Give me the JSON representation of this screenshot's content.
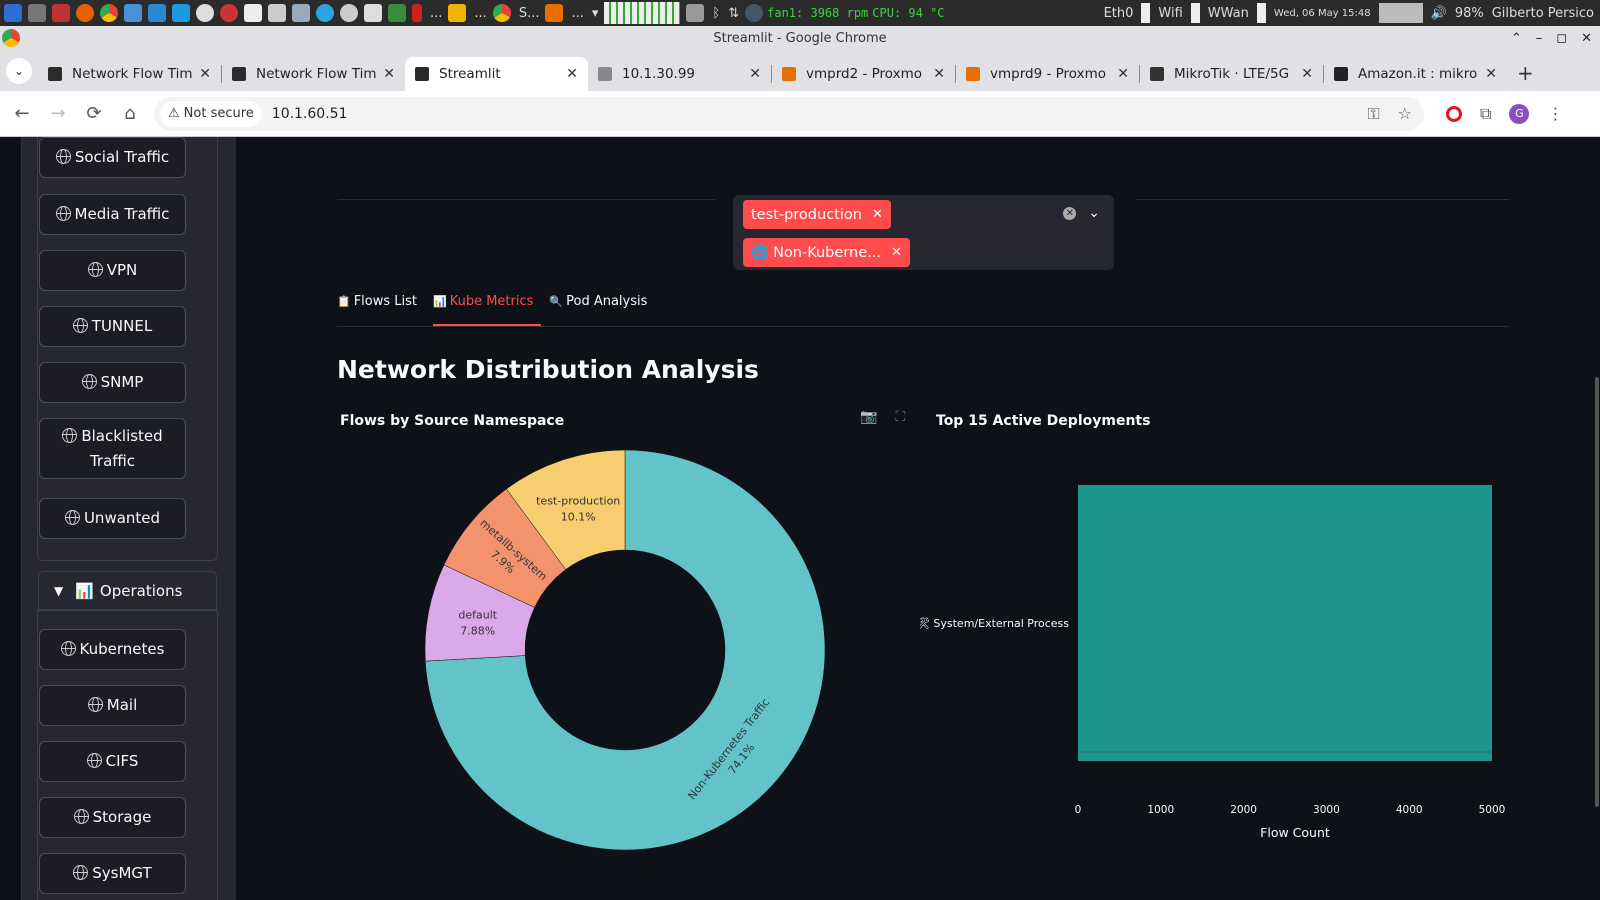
{
  "taskbar": {
    "item1": "S...",
    "item2": "...",
    "fan": "fan1: 3968 rpm",
    "cpu": "CPU: 94 °C",
    "eth": "Eth0",
    "wifi": "Wifi",
    "wwan": "WWan",
    "clock": "Wed, 06 May  15:48",
    "battery": "98%",
    "user": "Gilberto Persico"
  },
  "window": {
    "title": "Streamlit - Google Chrome"
  },
  "tabs": [
    {
      "label": "Network Flow Tim",
      "color": "#2b2b2b"
    },
    {
      "label": "Network Flow Tim",
      "color": "#2b2b2b"
    },
    {
      "label": "Streamlit",
      "color": "#2b2b2b",
      "active": true
    },
    {
      "label": "10.1.30.99",
      "color": "#888"
    },
    {
      "label": "vmprd2 - Proxmo",
      "color": "#e57000"
    },
    {
      "label": "vmprd9 - Proxmo",
      "color": "#e57000"
    },
    {
      "label": "MikroTik · LTE/5G",
      "color": "#333"
    },
    {
      "label": "Amazon.it : mikro",
      "color": "#222"
    }
  ],
  "address": {
    "security": "Not secure",
    "url": "10.1.60.51",
    "profile_initial": "G"
  },
  "sidebar": {
    "group1_buttons": [
      "Social Traffic",
      "Media Traffic",
      "VPN",
      "TUNNEL",
      "SNMP",
      "Blacklisted Traffic",
      "Unwanted"
    ],
    "operations_label": "Operations",
    "group2_buttons": [
      "Kubernetes",
      "Mail",
      "CIFS",
      "Storage",
      "SysMGT"
    ]
  },
  "filter": {
    "chips": [
      "test-production",
      "Non-Kuberne..."
    ]
  },
  "main_tabs": [
    {
      "label": "Flows List",
      "icon": "clipboard-icon"
    },
    {
      "label": "Kube Metrics",
      "icon": "bar-chart-icon",
      "active": true
    },
    {
      "label": "Pod Analysis",
      "icon": "magnifier-icon"
    }
  ],
  "page_title": "Network Distribution Analysis",
  "colors": {
    "accent": "#ff4b4b",
    "teal": "#62c3c8",
    "bar": "#1f968b"
  },
  "chart_data": [
    {
      "type": "pie",
      "title": "Flows by Source Namespace",
      "hole": 0.5,
      "slices": [
        {
          "label": "Non-Kubernetes Traffic",
          "value": 74.1,
          "pct": "74.1%",
          "color": "#62c3c8"
        },
        {
          "label": "default",
          "value": 7.88,
          "pct": "7.88%",
          "color": "#dba8ea"
        },
        {
          "label": "metallb-system",
          "value": 7.9,
          "pct": "7.9%",
          "color": "#f2936e"
        },
        {
          "label": "test-production",
          "value": 10.1,
          "pct": "10.1%",
          "color": "#f6ce6f"
        }
      ]
    },
    {
      "type": "bar",
      "orientation": "horizontal",
      "title": "Top 15 Active Deployments",
      "categories": [
        "System/External Process"
      ],
      "values": [
        5000
      ],
      "xlabel": "Flow Count",
      "xlim": [
        0,
        5000
      ],
      "xticks": [
        0,
        1000,
        2000,
        3000,
        4000,
        5000
      ]
    }
  ]
}
